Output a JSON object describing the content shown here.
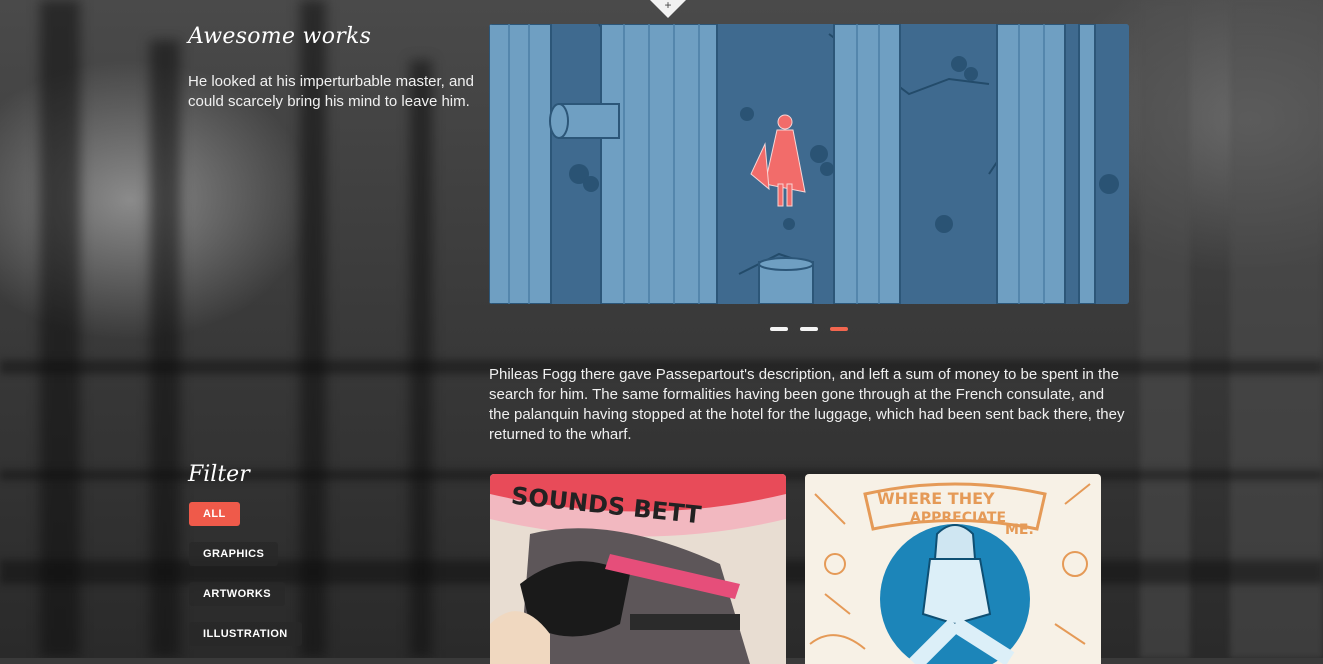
{
  "intro": {
    "title": "Awesome works",
    "text": "He looked at his imperturbable master, and could scarcely bring his mind to leave him."
  },
  "top_tab": {
    "icon": "plus-icon",
    "glyph": "+"
  },
  "slider": {
    "slide_count": 3,
    "active_index": 2
  },
  "body": {
    "text": "Phileas Fogg there gave Passepartout's description, and left a sum of money to be spent in the search for him. The same formalities having been gone through at the French consulate, and the palanquin having stopped at the hotel for the luggage, which had been sent back there, they returned to the wharf."
  },
  "filter": {
    "title": "Filter",
    "buttons": [
      "ALL",
      "GRAPHICS",
      "ARTWORKS",
      "ILLUSTRATION"
    ],
    "active": "ALL"
  },
  "thumbnails": {
    "first_text": "SOUNDS BETT",
    "second_text_1": "WHERE THEY",
    "second_text_2": "APPRECIATE",
    "second_text_3": "ME."
  },
  "colors": {
    "accent": "#ef5a4a",
    "slider_blue": "#3f6a8f",
    "text": "#f0f0f0"
  }
}
